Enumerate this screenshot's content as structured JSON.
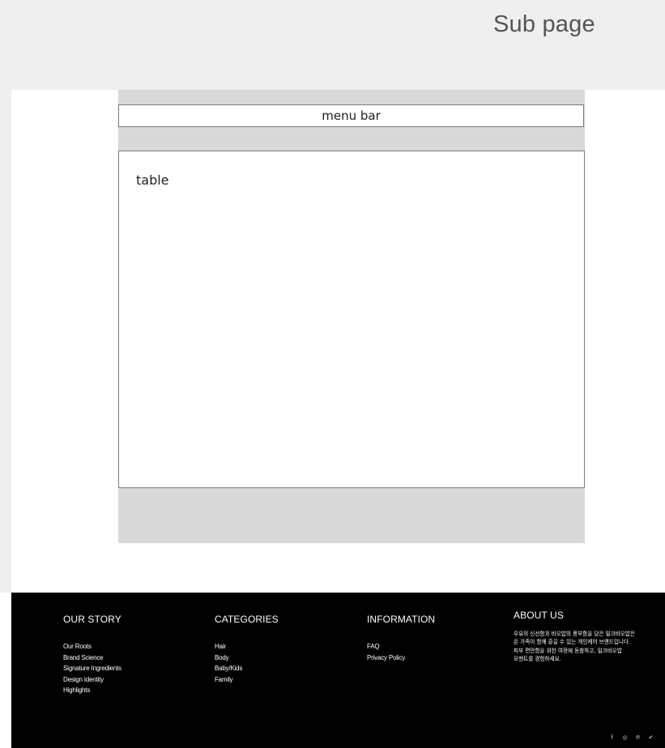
{
  "header": {
    "page_label": "Sub page"
  },
  "main": {
    "menu_bar_label": "menu bar",
    "table_label": "table"
  },
  "footer": {
    "our_story": {
      "heading": "OUR STORY",
      "links": [
        "Our Roots",
        "Brand Science",
        "Signature Ingredients",
        "Design Identity",
        "Highlights"
      ]
    },
    "categories": {
      "heading": "CATEGORIES",
      "links": [
        "Hair",
        "Body",
        "Baby/Kids",
        "Family"
      ]
    },
    "information": {
      "heading": "INFORMATION",
      "links": [
        "FAQ",
        "Privacy Policy"
      ]
    },
    "about_us": {
      "heading": "ABOUT US",
      "text": "우유의 신선함과 바오밥의 풍부함을 담은 밀크바오밥은 온 가족이 함께 즐길 수 있는 개인케어 브랜드입니다. 피부 편안함을 위한 여정에 동참하고, 밀크바오밥 모멘트를 경험하세요."
    },
    "social": {
      "icons": [
        "facebook-icon",
        "instagram-icon",
        "pinterest-icon",
        "twitter-icon"
      ],
      "glyphs": [
        "f",
        "◎",
        "℗",
        "✔"
      ]
    }
  },
  "colors": {
    "top_band": "#efefef",
    "content_gray": "#d9d9d9",
    "footer_bg": "#000000",
    "footer_text": "#ffffff"
  }
}
